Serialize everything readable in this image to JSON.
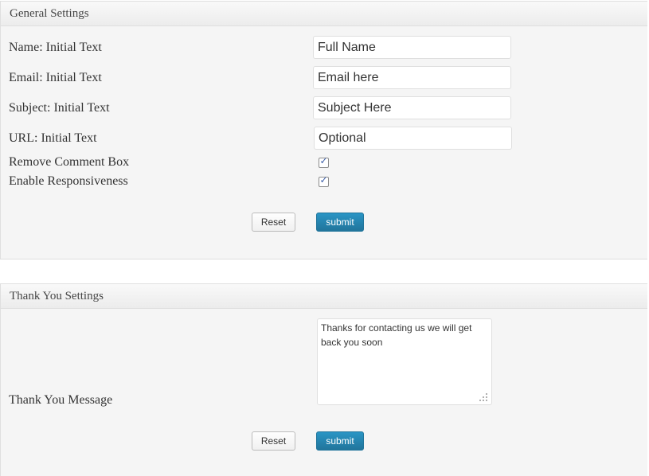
{
  "general": {
    "title": "General Settings",
    "name_label": "Name: Initial Text",
    "name_value": "Full Name",
    "email_label": "Email: Initial Text",
    "email_value": "Email here",
    "subject_label": "Subject: Initial Text",
    "subject_value": "Subject Here",
    "url_label": "URL: Initial Text",
    "url_value": "Optional",
    "remove_comment_label": "Remove Comment Box",
    "remove_comment_checked": true,
    "responsive_label": "Enable Responsiveness",
    "responsive_checked": true,
    "reset_label": "Reset",
    "submit_label": "submit"
  },
  "thankyou": {
    "title": "Thank You Settings",
    "message_label": "Thank You Message",
    "message_value": "Thanks for contacting us we will get back you soon",
    "reset_label": "Reset",
    "submit_label": "submit"
  },
  "colors": {
    "submit_bg": "#21759b",
    "checkmark": "#3b5ea8",
    "panel_bg": "#f5f5f5"
  }
}
